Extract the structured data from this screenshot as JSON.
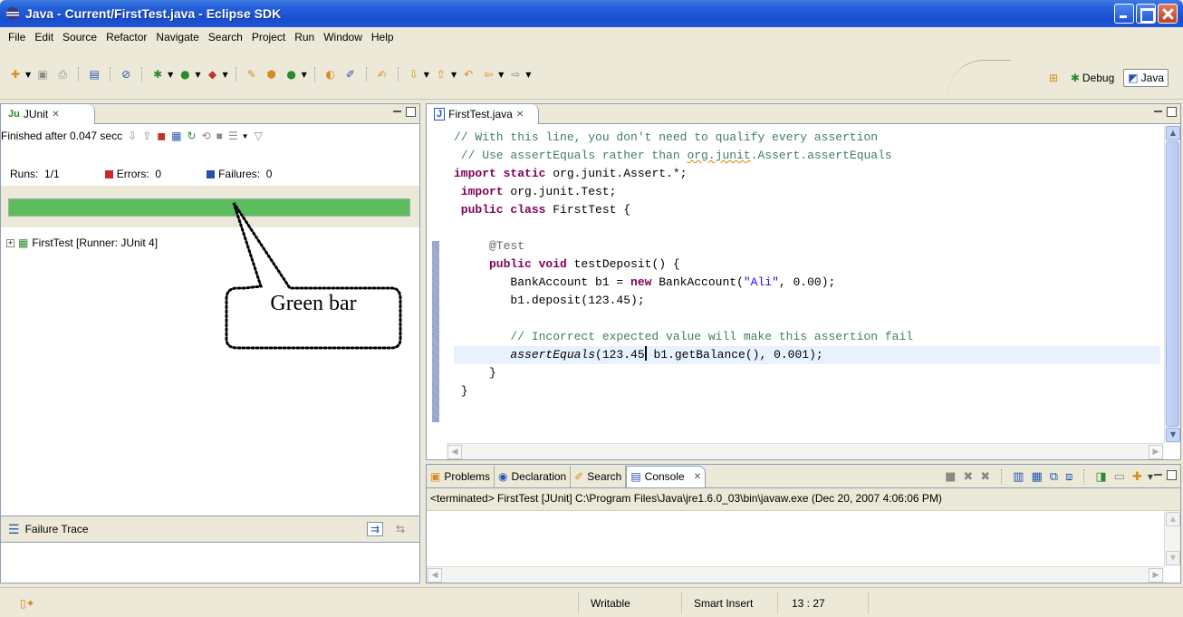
{
  "window": {
    "title": "Java - Current/FirstTest.java - Eclipse SDK"
  },
  "menu": [
    "File",
    "Edit",
    "Source",
    "Refactor",
    "Navigate",
    "Search",
    "Project",
    "Run",
    "Window",
    "Help"
  ],
  "perspectives": {
    "debug": "Debug",
    "java": "Java"
  },
  "junit": {
    "tab": "JUnit",
    "finished": "Finished after 0.047 secc",
    "runs_label": "Runs:",
    "runs_value": "1/1",
    "errors_label": "Errors:",
    "errors_value": "0",
    "failures_label": "Failures:",
    "failures_value": "0",
    "progress": 1.0,
    "tree_item": "FirstTest [Runner: JUnit 4]",
    "failure_trace": "Failure Trace"
  },
  "editor": {
    "tab": "FirstTest.java",
    "lines": [
      {
        "c": [
          [
            "cm",
            "// With this line, you don't need to qualify every assertion"
          ]
        ]
      },
      {
        "c": [
          [
            "cm",
            " // Use assertEquals rather than "
          ],
          [
            "cmsq",
            "org.junit"
          ],
          [
            "cm",
            ".Assert.assertEquals"
          ]
        ]
      },
      {
        "c": [
          [
            "kw",
            "import static"
          ],
          [
            "t",
            " org.junit.Assert.*;"
          ]
        ]
      },
      {
        "c": [
          [
            "kw",
            " import"
          ],
          [
            "t",
            " org.junit.Test;"
          ]
        ]
      },
      {
        "c": [
          [
            "kw",
            " public class"
          ],
          [
            "t",
            " FirstTest {"
          ]
        ]
      },
      {
        "c": [
          [
            "t",
            ""
          ]
        ]
      },
      {
        "c": [
          [
            "ann",
            "     @Test"
          ]
        ]
      },
      {
        "c": [
          [
            "kw",
            "     public void"
          ],
          [
            "t",
            " testDeposit() {"
          ]
        ]
      },
      {
        "c": [
          [
            "t",
            "        BankAccount b1 = "
          ],
          [
            "kw",
            "new"
          ],
          [
            "t",
            " BankAccount("
          ],
          [
            "str",
            "\"Ali\""
          ],
          [
            "t",
            ", 0.00);"
          ]
        ]
      },
      {
        "c": [
          [
            "t",
            "        b1.deposit(123.45);"
          ]
        ]
      },
      {
        "c": [
          [
            "t",
            ""
          ]
        ]
      },
      {
        "c": [
          [
            "cm",
            "        // Incorrect expected value will make this assertion fail"
          ]
        ]
      },
      {
        "c": [
          [
            "it",
            "        assertEquals"
          ],
          [
            "t",
            "(123.45"
          ],
          [
            "caret",
            ""
          ],
          [
            "t",
            " b1.getBalance(), 0.001);"
          ]
        ],
        "hl": true
      },
      {
        "c": [
          [
            "t",
            "     }"
          ]
        ]
      },
      {
        "c": [
          [
            "t",
            " }"
          ]
        ]
      }
    ]
  },
  "console": {
    "tabs": [
      "Problems",
      "Declaration",
      "Search",
      "Console"
    ],
    "terminated": "<terminated> FirstTest [JUnit] C:\\Program Files\\Java\\jre1.6.0_03\\bin\\javaw.exe (Dec 20, 2007 4:06:06 PM)"
  },
  "status": {
    "writable": "Writable",
    "insert": "Smart Insert",
    "position": "13 : 27"
  },
  "annotation": {
    "label": "Green bar"
  },
  "colors": {
    "green_bar": "#5bbd5e"
  }
}
